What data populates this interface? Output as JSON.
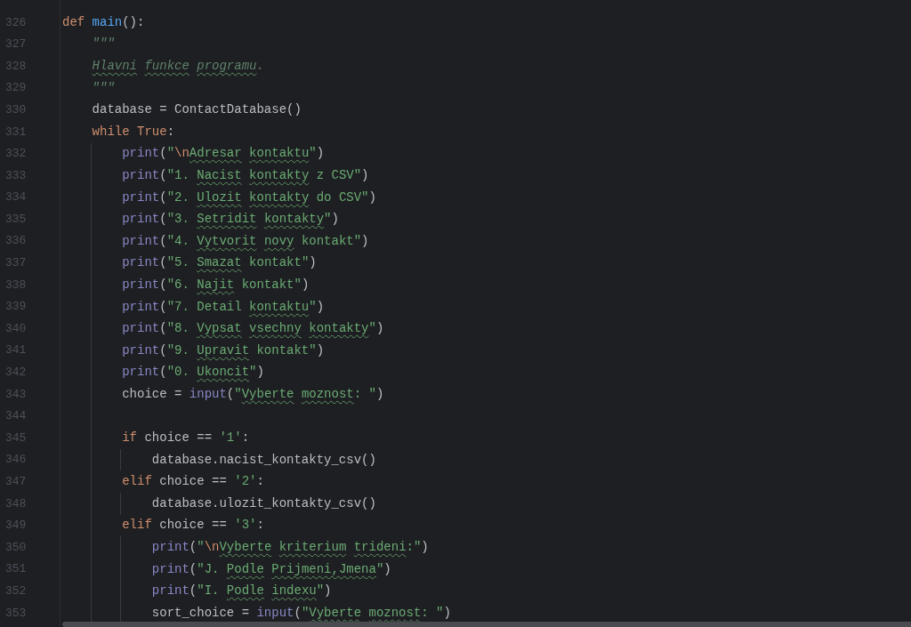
{
  "editor": {
    "lines": [
      {
        "number": "326",
        "tokens": [
          {
            "kind": "keyword",
            "text": "def "
          },
          {
            "kind": "function",
            "text": "main"
          },
          {
            "kind": "plain",
            "text": "():"
          }
        ]
      },
      {
        "number": "327",
        "tokens": [
          {
            "kind": "docstring",
            "text": "    \"\"\""
          }
        ]
      },
      {
        "number": "328",
        "tokens": [
          {
            "kind": "docstring",
            "text": "    Hlavni ",
            "typo": true
          },
          {
            "kind": "docstring",
            "text": "funkce ",
            "typo": true
          },
          {
            "kind": "docstring",
            "text": "programu",
            "typo": true
          },
          {
            "kind": "docstring",
            "text": "."
          }
        ]
      },
      {
        "number": "329",
        "tokens": [
          {
            "kind": "docstring",
            "text": "    \"\"\""
          }
        ]
      },
      {
        "number": "330",
        "tokens": [
          {
            "kind": "plain",
            "text": "    database = ContactDatabase()"
          }
        ]
      },
      {
        "number": "331",
        "tokens": [
          {
            "kind": "keyword",
            "text": "    while "
          },
          {
            "kind": "keyword",
            "text": "True"
          },
          {
            "kind": "plain",
            "text": ":"
          }
        ]
      },
      {
        "number": "332",
        "tokens": [
          {
            "kind": "builtin",
            "text": "        print"
          },
          {
            "kind": "plain",
            "text": "("
          },
          {
            "kind": "string",
            "text": "\""
          },
          {
            "kind": "escape",
            "text": "\\n"
          },
          {
            "kind": "string",
            "text": "Adresar ",
            "typo": true
          },
          {
            "kind": "string",
            "text": "kontaktu",
            "typo": true
          },
          {
            "kind": "string",
            "text": "\""
          },
          {
            "kind": "plain",
            "text": ")"
          }
        ]
      },
      {
        "number": "333",
        "tokens": [
          {
            "kind": "builtin",
            "text": "        print"
          },
          {
            "kind": "plain",
            "text": "("
          },
          {
            "kind": "string",
            "text": "\"1. "
          },
          {
            "kind": "string",
            "text": "Nacist ",
            "typo": true
          },
          {
            "kind": "string",
            "text": "kontakty",
            "typo": true
          },
          {
            "kind": "string",
            "text": " z CSV\""
          },
          {
            "kind": "plain",
            "text": ")"
          }
        ]
      },
      {
        "number": "334",
        "tokens": [
          {
            "kind": "builtin",
            "text": "        print"
          },
          {
            "kind": "plain",
            "text": "("
          },
          {
            "kind": "string",
            "text": "\"2. "
          },
          {
            "kind": "string",
            "text": "Ulozit ",
            "typo": true
          },
          {
            "kind": "string",
            "text": "kontakty",
            "typo": true
          },
          {
            "kind": "string",
            "text": " do CSV\""
          },
          {
            "kind": "plain",
            "text": ")"
          }
        ]
      },
      {
        "number": "335",
        "tokens": [
          {
            "kind": "builtin",
            "text": "        print"
          },
          {
            "kind": "plain",
            "text": "("
          },
          {
            "kind": "string",
            "text": "\"3. "
          },
          {
            "kind": "string",
            "text": "Setridit ",
            "typo": true
          },
          {
            "kind": "string",
            "text": "kontakty",
            "typo": true
          },
          {
            "kind": "string",
            "text": "\""
          },
          {
            "kind": "plain",
            "text": ")"
          }
        ]
      },
      {
        "number": "336",
        "tokens": [
          {
            "kind": "builtin",
            "text": "        print"
          },
          {
            "kind": "plain",
            "text": "("
          },
          {
            "kind": "string",
            "text": "\"4. "
          },
          {
            "kind": "string",
            "text": "Vytvorit ",
            "typo": true
          },
          {
            "kind": "string",
            "text": "novy",
            "typo": true
          },
          {
            "kind": "string",
            "text": " kontakt\""
          },
          {
            "kind": "plain",
            "text": ")"
          }
        ]
      },
      {
        "number": "337",
        "tokens": [
          {
            "kind": "builtin",
            "text": "        print"
          },
          {
            "kind": "plain",
            "text": "("
          },
          {
            "kind": "string",
            "text": "\"5. "
          },
          {
            "kind": "string",
            "text": "Smazat",
            "typo": true
          },
          {
            "kind": "string",
            "text": " kontakt\""
          },
          {
            "kind": "plain",
            "text": ")"
          }
        ]
      },
      {
        "number": "338",
        "tokens": [
          {
            "kind": "builtin",
            "text": "        print"
          },
          {
            "kind": "plain",
            "text": "("
          },
          {
            "kind": "string",
            "text": "\"6. "
          },
          {
            "kind": "string",
            "text": "Najit",
            "typo": true
          },
          {
            "kind": "string",
            "text": " kontakt\""
          },
          {
            "kind": "plain",
            "text": ")"
          }
        ]
      },
      {
        "number": "339",
        "tokens": [
          {
            "kind": "builtin",
            "text": "        print"
          },
          {
            "kind": "plain",
            "text": "("
          },
          {
            "kind": "string",
            "text": "\"7. Detail "
          },
          {
            "kind": "string",
            "text": "kontaktu",
            "typo": true
          },
          {
            "kind": "string",
            "text": "\""
          },
          {
            "kind": "plain",
            "text": ")"
          }
        ]
      },
      {
        "number": "340",
        "tokens": [
          {
            "kind": "builtin",
            "text": "        print"
          },
          {
            "kind": "plain",
            "text": "("
          },
          {
            "kind": "string",
            "text": "\"8. "
          },
          {
            "kind": "string",
            "text": "Vypsat ",
            "typo": true
          },
          {
            "kind": "string",
            "text": "vsechny ",
            "typo": true
          },
          {
            "kind": "string",
            "text": "kontakty",
            "typo": true
          },
          {
            "kind": "string",
            "text": "\""
          },
          {
            "kind": "plain",
            "text": ")"
          }
        ]
      },
      {
        "number": "341",
        "tokens": [
          {
            "kind": "builtin",
            "text": "        print"
          },
          {
            "kind": "plain",
            "text": "("
          },
          {
            "kind": "string",
            "text": "\"9. "
          },
          {
            "kind": "string",
            "text": "Upravit",
            "typo": true
          },
          {
            "kind": "string",
            "text": " kontakt\""
          },
          {
            "kind": "plain",
            "text": ")"
          }
        ]
      },
      {
        "number": "342",
        "tokens": [
          {
            "kind": "builtin",
            "text": "        print"
          },
          {
            "kind": "plain",
            "text": "("
          },
          {
            "kind": "string",
            "text": "\"0. "
          },
          {
            "kind": "string",
            "text": "Ukoncit",
            "typo": true
          },
          {
            "kind": "string",
            "text": "\""
          },
          {
            "kind": "plain",
            "text": ")"
          }
        ]
      },
      {
        "number": "343",
        "tokens": [
          {
            "kind": "plain",
            "text": "        choice = "
          },
          {
            "kind": "builtin",
            "text": "input"
          },
          {
            "kind": "plain",
            "text": "("
          },
          {
            "kind": "string",
            "text": "\""
          },
          {
            "kind": "string",
            "text": "Vyberte ",
            "typo": true
          },
          {
            "kind": "string",
            "text": "moznost",
            "typo": true
          },
          {
            "kind": "string",
            "text": ": \""
          },
          {
            "kind": "plain",
            "text": ")"
          }
        ]
      },
      {
        "number": "344"
      },
      {
        "number": "345",
        "tokens": [
          {
            "kind": "keyword",
            "text": "        if"
          },
          {
            "kind": "plain",
            "text": " choice == "
          },
          {
            "kind": "string",
            "text": "'1'"
          },
          {
            "kind": "plain",
            "text": ":"
          }
        ]
      },
      {
        "number": "346",
        "tokens": [
          {
            "kind": "plain",
            "text": "            database.nacist_kontakty_csv()"
          }
        ]
      },
      {
        "number": "347",
        "tokens": [
          {
            "kind": "keyword",
            "text": "        elif"
          },
          {
            "kind": "plain",
            "text": " choice == "
          },
          {
            "kind": "string",
            "text": "'2'"
          },
          {
            "kind": "plain",
            "text": ":"
          }
        ]
      },
      {
        "number": "348",
        "tokens": [
          {
            "kind": "plain",
            "text": "            database.ulozit_kontakty_csv()"
          }
        ]
      },
      {
        "number": "349",
        "tokens": [
          {
            "kind": "keyword",
            "text": "        elif"
          },
          {
            "kind": "plain",
            "text": " choice == "
          },
          {
            "kind": "string",
            "text": "'3'"
          },
          {
            "kind": "plain",
            "text": ":"
          }
        ]
      },
      {
        "number": "350",
        "tokens": [
          {
            "kind": "builtin",
            "text": "            print"
          },
          {
            "kind": "plain",
            "text": "("
          },
          {
            "kind": "string",
            "text": "\""
          },
          {
            "kind": "escape",
            "text": "\\n"
          },
          {
            "kind": "string",
            "text": "Vyberte ",
            "typo": true
          },
          {
            "kind": "string",
            "text": "kriterium ",
            "typo": true
          },
          {
            "kind": "string",
            "text": "trideni",
            "typo": true
          },
          {
            "kind": "string",
            "text": ":\""
          },
          {
            "kind": "plain",
            "text": ")"
          }
        ]
      },
      {
        "number": "351",
        "tokens": [
          {
            "kind": "builtin",
            "text": "            print"
          },
          {
            "kind": "plain",
            "text": "("
          },
          {
            "kind": "string",
            "text": "\"J. "
          },
          {
            "kind": "string",
            "text": "Podle ",
            "typo": true
          },
          {
            "kind": "string",
            "text": "Prijmeni,Jmena",
            "typo": true
          },
          {
            "kind": "string",
            "text": "\""
          },
          {
            "kind": "plain",
            "text": ")"
          }
        ]
      },
      {
        "number": "352",
        "tokens": [
          {
            "kind": "builtin",
            "text": "            print"
          },
          {
            "kind": "plain",
            "text": "("
          },
          {
            "kind": "string",
            "text": "\"I. "
          },
          {
            "kind": "string",
            "text": "Podle ",
            "typo": true
          },
          {
            "kind": "string",
            "text": "indexu",
            "typo": true
          },
          {
            "kind": "string",
            "text": "\""
          },
          {
            "kind": "plain",
            "text": ")"
          }
        ]
      },
      {
        "number": "353",
        "tokens": [
          {
            "kind": "plain",
            "text": "            sort_choice = "
          },
          {
            "kind": "builtin",
            "text": "input"
          },
          {
            "kind": "plain",
            "text": "("
          },
          {
            "kind": "string",
            "text": "\""
          },
          {
            "kind": "string",
            "text": "Vyberte ",
            "typo": true
          },
          {
            "kind": "string",
            "text": "moznost",
            "typo": true
          },
          {
            "kind": "string",
            "text": ": \""
          },
          {
            "kind": "plain",
            "text": ")"
          }
        ]
      }
    ]
  }
}
